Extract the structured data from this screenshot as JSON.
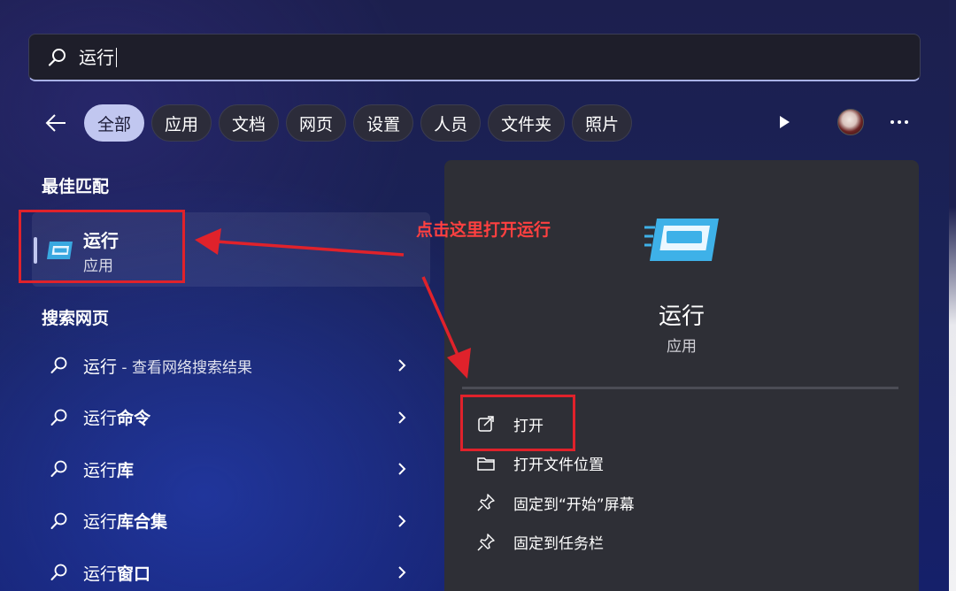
{
  "search": {
    "value": "运行"
  },
  "filters": {
    "chips": [
      "全部",
      "应用",
      "文档",
      "网页",
      "设置",
      "人员",
      "文件夹",
      "照片"
    ],
    "active_index": 0
  },
  "best_match": {
    "section_title": "最佳匹配",
    "title": "运行",
    "subtitle": "应用"
  },
  "web_search": {
    "section_title": "搜索网页",
    "items": [
      {
        "prefix": "运行",
        "suffix": " - 查看网络搜索结果",
        "suffix_style": "muted"
      },
      {
        "prefix": "运行",
        "suffix": "命令",
        "suffix_style": "bold"
      },
      {
        "prefix": "运行",
        "suffix": "库",
        "suffix_style": "bold"
      },
      {
        "prefix": "运行",
        "suffix": "库合集",
        "suffix_style": "bold"
      },
      {
        "prefix": "运行",
        "suffix": "窗口",
        "suffix_style": "bold"
      }
    ]
  },
  "detail": {
    "title": "运行",
    "subtitle": "应用",
    "actions": [
      {
        "label": "打开",
        "icon": "open-external-icon"
      },
      {
        "label": "打开文件位置",
        "icon": "folder-icon"
      },
      {
        "label": "固定到“开始”屏幕",
        "icon": "pin-icon"
      },
      {
        "label": "固定到任务栏",
        "icon": "pin-icon"
      }
    ]
  },
  "annotation": {
    "text": "点击这里打开运行",
    "color": "#e0222b"
  },
  "colors": {
    "accent": "#c1c7f0",
    "panel": "#2e2f36",
    "annotation_red": "#e0222b"
  }
}
